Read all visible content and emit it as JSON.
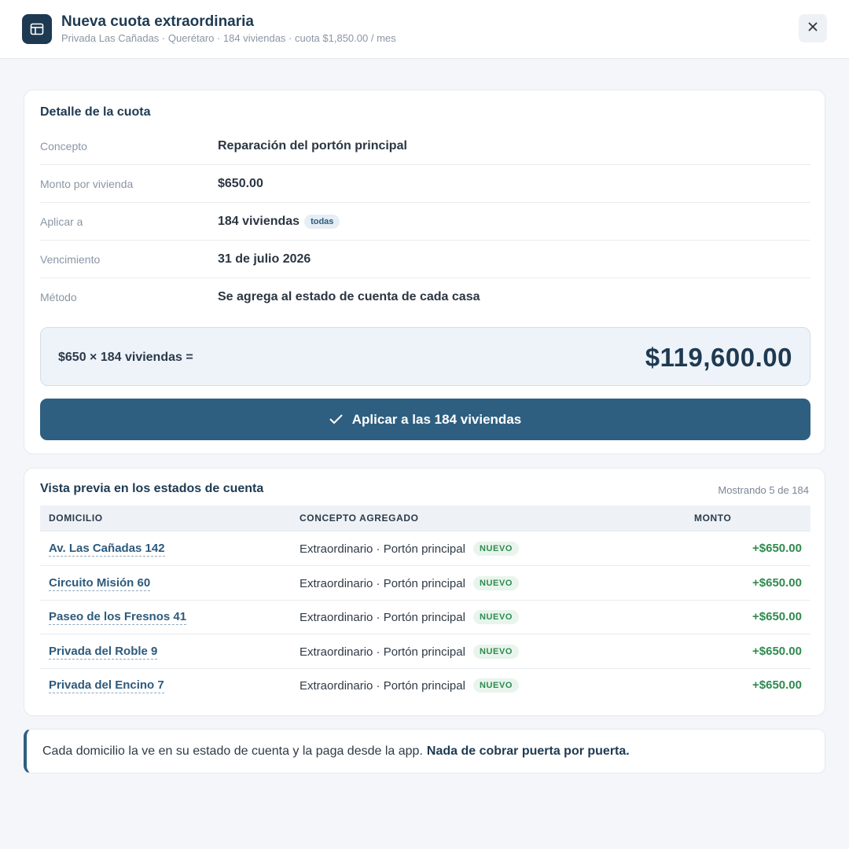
{
  "header": {
    "title": "Nueva cuota extraordinaria",
    "subtitle": "Privada Las Cañadas · Querétaro · 184 viviendas · cuota $1,850.00 / mes",
    "app_icon": "table-icon",
    "close_icon": "close-icon"
  },
  "detail": {
    "title": "Detalle de la cuota",
    "rows": [
      {
        "label": "Concepto",
        "value": "Reparación del portón principal"
      },
      {
        "label": "Monto por vivienda",
        "value": "$650.00"
      },
      {
        "label": "Aplicar a",
        "value": "184 viviendas",
        "badge": "todas"
      },
      {
        "label": "Vencimiento",
        "value": "31 de julio 2026"
      },
      {
        "label": "Método",
        "value": "Se agrega al estado de cuenta de cada casa"
      }
    ],
    "calc_formula": "$650 × 184 viviendas =",
    "calc_total": "$119,600.00",
    "apply_button": "Aplicar a las 184 viviendas",
    "apply_icon": "check-icon"
  },
  "preview": {
    "title": "Vista previa en los estados de cuenta",
    "showing": "Mostrando 5 de 184",
    "columns": [
      "DOMICILIO",
      "CONCEPTO AGREGADO",
      "MONTO"
    ],
    "rows": [
      {
        "address": "Av. Las Cañadas 142",
        "concept": "Extraordinario · Portón principal",
        "badge": "NUEVO",
        "amount": "+$650.00"
      },
      {
        "address": "Circuito Misión 60",
        "concept": "Extraordinario · Portón principal",
        "badge": "NUEVO",
        "amount": "+$650.00"
      },
      {
        "address": "Paseo de los Fresnos 41",
        "concept": "Extraordinario · Portón principal",
        "badge": "NUEVO",
        "amount": "+$650.00"
      },
      {
        "address": "Privada del Roble 9",
        "concept": "Extraordinario · Portón principal",
        "badge": "NUEVO",
        "amount": "+$650.00"
      },
      {
        "address": "Privada del Encino 7",
        "concept": "Extraordinario · Portón principal",
        "badge": "NUEVO",
        "amount": "+$650.00"
      }
    ]
  },
  "note": {
    "text": "Cada domicilio la ve en su estado de cuenta y la paga desde la app.",
    "emphasis": "Nada de cobrar puerta por puerta."
  },
  "colors": {
    "primary": "#2e5f80",
    "dark": "#1e3a52",
    "positive": "#2f8a4f"
  }
}
